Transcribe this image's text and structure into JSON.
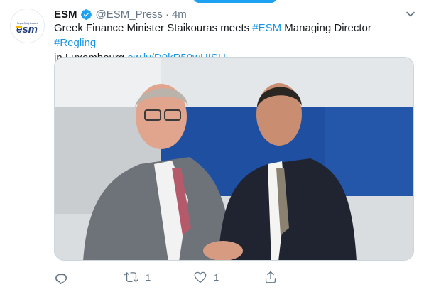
{
  "tweet": {
    "author_name": "ESM",
    "handle": "@ESM_Press",
    "separator": "·",
    "time": "4m",
    "text_parts": [
      {
        "text": "Greek Finance Minister Staikouras meets ",
        "link": false
      },
      {
        "text": "#ESM",
        "link": true
      },
      {
        "text": " Managing Director ",
        "link": false
      },
      {
        "text": "#Regling",
        "link": true
      },
      {
        "text": " in Luxembourg ",
        "link": false
      },
      {
        "text": "ow.ly/D0kR50wHISU",
        "link": true
      }
    ],
    "avatar": {
      "logo_text": "esm",
      "tagline": "European Stability Mechanism"
    },
    "actions": {
      "reply_count": "",
      "retweet_count": "1",
      "like_count": "1"
    }
  },
  "colors": {
    "accent": "#1da1f2",
    "link": "#1b95e0",
    "muted": "#657786",
    "esm_blue": "#1f3d7a",
    "esm_yellow": "#f2b705"
  },
  "icons": [
    "verified-badge-icon",
    "chevron-down-icon",
    "reply-icon",
    "retweet-icon",
    "like-icon",
    "share-icon"
  ]
}
